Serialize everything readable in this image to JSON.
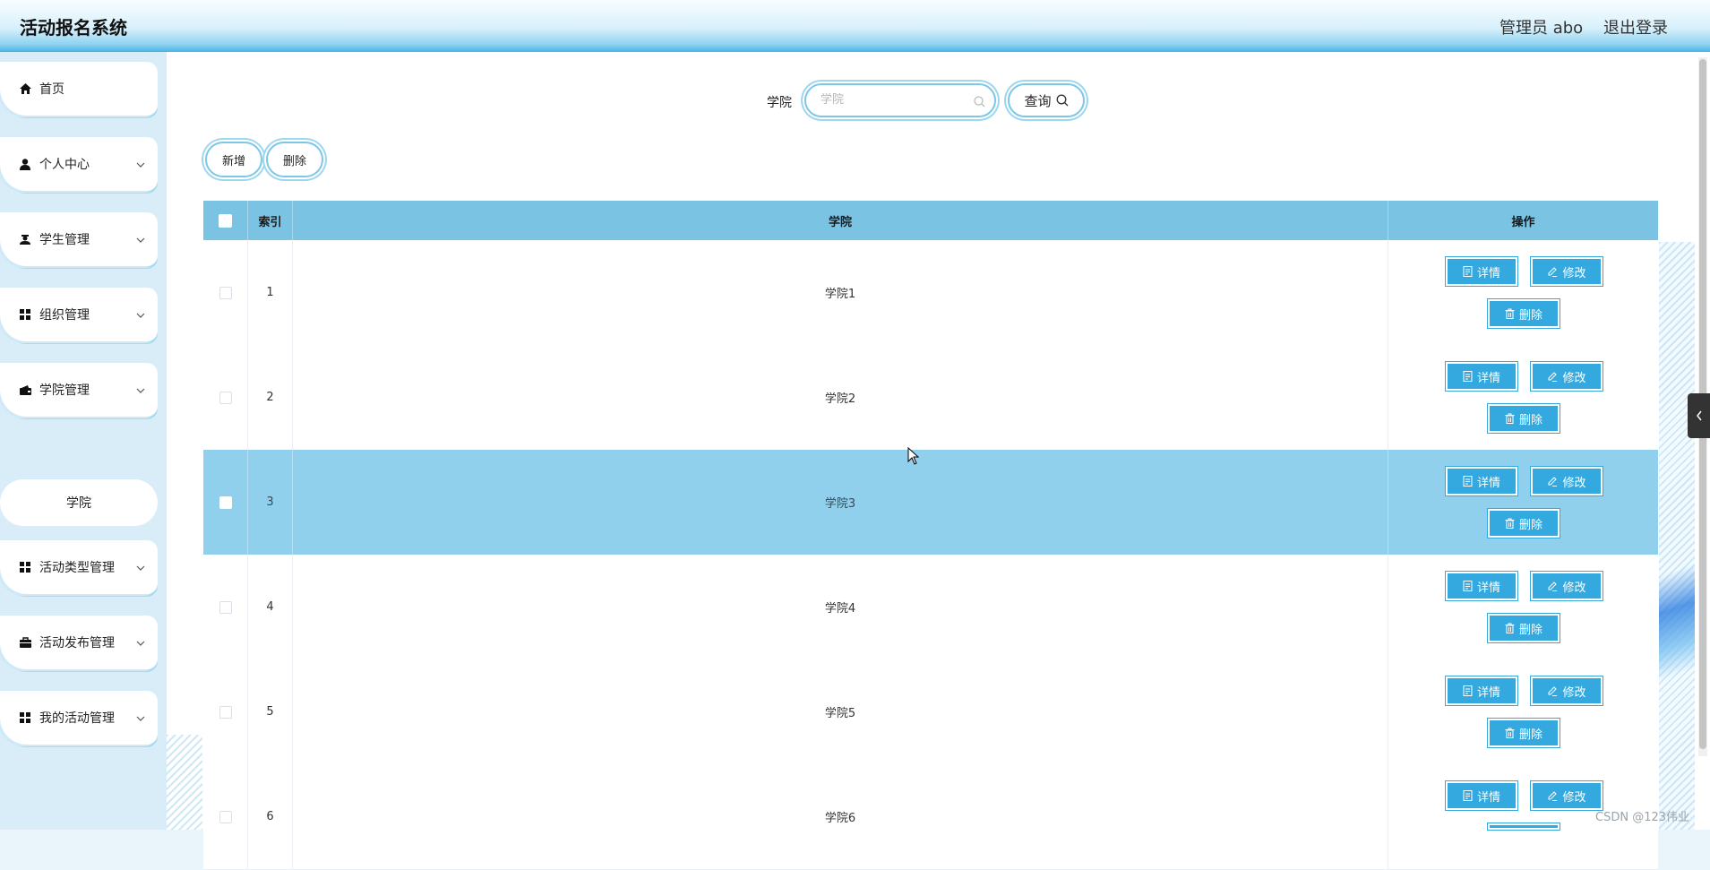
{
  "header": {
    "title": "活动报名系统",
    "admin": "管理员 abo",
    "logout": "退出登录"
  },
  "sidebar": {
    "items": [
      {
        "label": "首页",
        "icon": "home-icon"
      },
      {
        "label": "个人中心",
        "icon": "user-icon"
      },
      {
        "label": "学生管理",
        "icon": "student-icon"
      },
      {
        "label": "组织管理",
        "icon": "grid-icon"
      },
      {
        "label": "学院管理",
        "icon": "wallet-icon"
      },
      {
        "label": "活动类型管理",
        "icon": "grid-icon"
      },
      {
        "label": "活动发布管理",
        "icon": "briefcase-icon"
      },
      {
        "label": "我的活动管理",
        "icon": "grid-icon"
      }
    ],
    "submenu": {
      "label": "学院"
    }
  },
  "search": {
    "label": "学院",
    "placeholder": "学院",
    "value": "",
    "button": "查询"
  },
  "toolbar": {
    "add": "新增",
    "delete": "删除"
  },
  "table": {
    "headers": [
      "索引",
      "学院",
      "操作"
    ],
    "rows": [
      {
        "index": "1",
        "college": "学院1"
      },
      {
        "index": "2",
        "college": "学院2"
      },
      {
        "index": "3",
        "college": "学院3"
      },
      {
        "index": "4",
        "college": "学院4"
      },
      {
        "index": "5",
        "college": "学院5"
      },
      {
        "index": "6",
        "college": "学院6"
      }
    ],
    "actions": {
      "detail": "详情",
      "edit": "修改",
      "delete": "删除"
    },
    "highlighted_row": 3
  },
  "watermark": "CSDN @123伟业",
  "colors": {
    "accent": "#34a9df",
    "header_bg": "#7bc3e2",
    "highlight_row": "#90d0ec",
    "sidebar_bg": "#d9edf8"
  }
}
